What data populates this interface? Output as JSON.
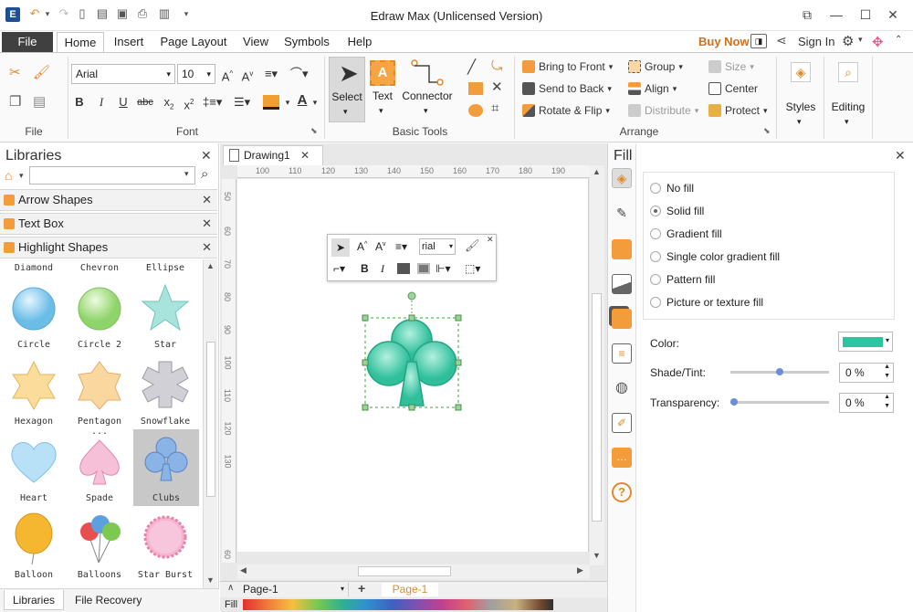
{
  "window": {
    "title": "Edraw Max (Unlicensed Version)"
  },
  "menu": {
    "file": "File",
    "tabs": [
      "Home",
      "Insert",
      "Page Layout",
      "View",
      "Symbols",
      "Help"
    ],
    "buy_now": "Buy Now",
    "sign_in": "Sign In"
  },
  "ribbon": {
    "groups": {
      "file": "File",
      "font": "Font",
      "basic_tools": "Basic Tools",
      "arrange": "Arrange"
    },
    "font": {
      "family": "Arial",
      "size": "10"
    },
    "basic_tools": {
      "select": "Select",
      "text": "Text",
      "connector": "Connector"
    },
    "arrange": {
      "bring_to_front": "Bring to Front",
      "send_to_back": "Send to Back",
      "rotate_flip": "Rotate & Flip",
      "group": "Group",
      "align": "Align",
      "distribute": "Distribute",
      "size": "Size",
      "center": "Center",
      "protect": "Protect"
    },
    "styles": "Styles",
    "editing": "Editing"
  },
  "libraries": {
    "title": "Libraries",
    "search_placeholder": "",
    "categories": [
      "Arrow Shapes",
      "Text Box",
      "Highlight Shapes"
    ],
    "shapes": [
      {
        "label": "Diamond"
      },
      {
        "label": "Chevron"
      },
      {
        "label": "Ellipse"
      },
      {
        "label": "Circle"
      },
      {
        "label": "Circle 2"
      },
      {
        "label": "Star"
      },
      {
        "label": "Hexagon"
      },
      {
        "label": "Pentagon ..."
      },
      {
        "label": "Snowflake"
      },
      {
        "label": "Heart"
      },
      {
        "label": "Spade"
      },
      {
        "label": "Clubs"
      },
      {
        "label": "Balloon"
      },
      {
        "label": "Balloons"
      },
      {
        "label": "Star Burst"
      }
    ],
    "bottom_tabs": [
      "Libraries",
      "File Recovery"
    ]
  },
  "document": {
    "tab": "Drawing1",
    "ruler_top": [
      "100",
      "110",
      "120",
      "130",
      "140",
      "150",
      "160",
      "170",
      "180",
      "190"
    ],
    "ruler_left": [
      "50",
      "60",
      "70",
      "80",
      "90",
      "100",
      "110",
      "120",
      "130",
      "60"
    ],
    "floating_toolbar": {
      "font": "rial"
    },
    "page_selector": "Page-1",
    "page_tab": "Page-1",
    "fill_label": "Fill"
  },
  "fill_panel": {
    "title": "Fill",
    "options": [
      "No fill",
      "Solid fill",
      "Gradient fill",
      "Single color gradient fill",
      "Pattern fill",
      "Picture or texture fill"
    ],
    "selected": "Solid fill",
    "color_label": "Color:",
    "color": "#2ec4a0",
    "shade_label": "Shade/Tint:",
    "shade_value": "0 %",
    "shade_level": 0.5,
    "transparency_label": "Transparency:",
    "transparency_value": "0 %",
    "transparency_level": 0.0
  },
  "colors": {
    "accent": "#d0701f",
    "clubs": "#3cc7a4",
    "palette_start": "#e03030"
  }
}
